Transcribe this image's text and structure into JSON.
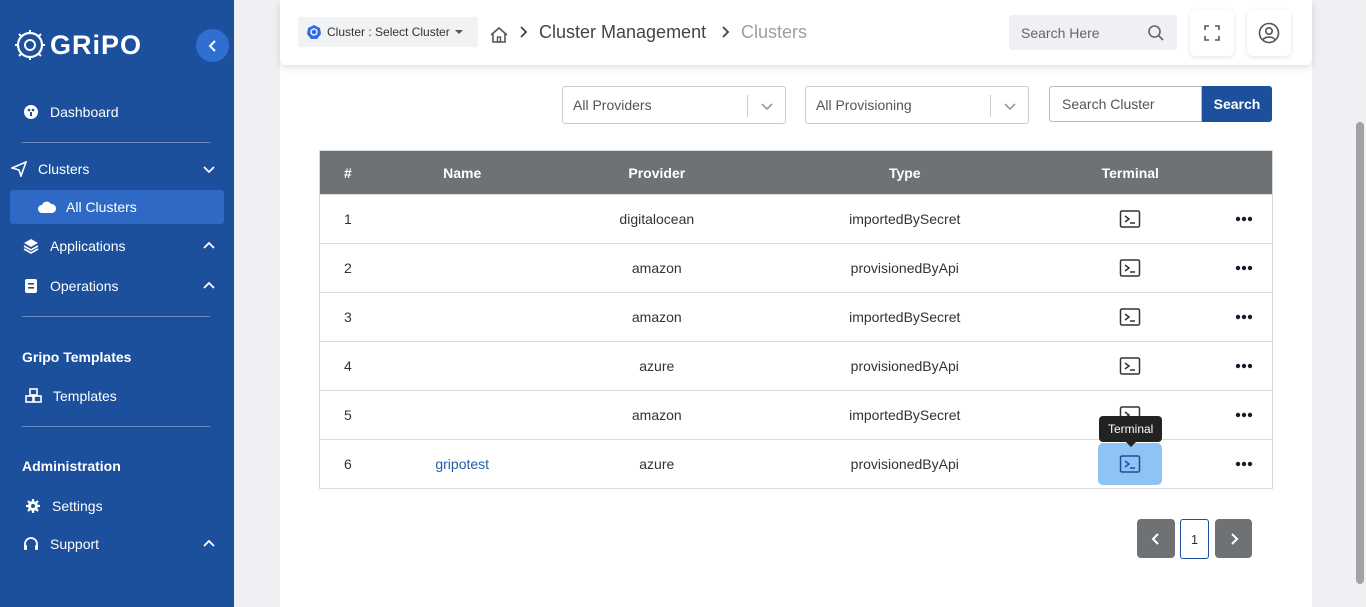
{
  "sidebar": {
    "brand": "GRiPO",
    "items": {
      "dashboard": "Dashboard",
      "clusters": "Clusters",
      "all_clusters": "All Clusters",
      "applications": "Applications",
      "operations": "Operations",
      "templates": "Templates",
      "settings": "Settings",
      "support": "Support"
    },
    "sections": {
      "gripo_templates": "Gripo Templates",
      "administration": "Administration"
    }
  },
  "topbar": {
    "cluster_select": "Cluster : Select Cluster",
    "breadcrumb": [
      "Cluster Management",
      "Clusters"
    ],
    "search_placeholder": "Search Here"
  },
  "filters": {
    "provider": "All Providers",
    "provisioning": "All Provisioning",
    "search_placeholder": "Search Cluster",
    "search_button": "Search"
  },
  "table": {
    "headers": [
      "#",
      "Name",
      "Provider",
      "Type",
      "Terminal",
      ""
    ],
    "rows": [
      {
        "num": "1",
        "name": "",
        "provider": "digitalocean",
        "type": "importedBySecret"
      },
      {
        "num": "2",
        "name": "",
        "provider": "amazon",
        "type": "provisionedByApi"
      },
      {
        "num": "3",
        "name": "",
        "provider": "amazon",
        "type": "importedBySecret"
      },
      {
        "num": "4",
        "name": "",
        "provider": "azure",
        "type": "provisionedByApi"
      },
      {
        "num": "5",
        "name": "",
        "provider": "amazon",
        "type": "importedBySecret"
      },
      {
        "num": "6",
        "name": "gripotest",
        "provider": "azure",
        "type": "provisionedByApi"
      }
    ]
  },
  "tooltip": "Terminal",
  "pagination": {
    "current": "1"
  },
  "colors": {
    "sidebar": "#1c4f9c",
    "accent": "#2f6fd0",
    "header": "#6e7275",
    "link": "#1f5fa8"
  }
}
